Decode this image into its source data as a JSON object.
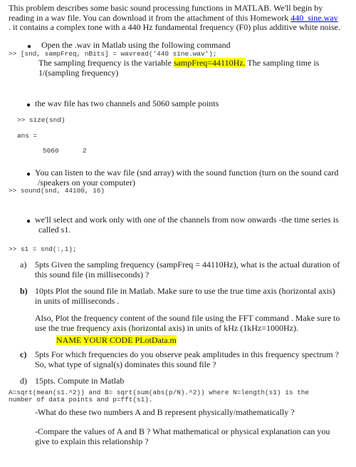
{
  "intro": {
    "line1": "This problem describes some basic sound processing functions in MATLAB. We'll begin by",
    "line2_prefix": "reading in a wav file. You can download it from the attachment of this Homework ",
    "link_text": "440_sine.wav",
    "line3": ". it contains a complex tone with a 440 Hz fundamental frequency (F0) plus additive white noise."
  },
  "bullet1": {
    "text": "Open the .wav in Matlab using the following command",
    "code": ">> [snd, sampFreq, nBits] = wavread('440 sine.wav');",
    "note_prefix": "The sampling frequency is the variable ",
    "note_highlight": "sampFreq=44110Hz.",
    "note_suffix": " The sampling time is",
    "note_line2": "1/(sampling frequency)"
  },
  "bullet2": {
    "text": "the wav file has two channels and 5060 sample points",
    "code1": ">> size(snd)",
    "code2": "ans =",
    "ans_rows": "5060",
    "ans_cols": "2"
  },
  "bullet3": {
    "line1": "You can listen to the wav file (snd array) with the sound function (turn on the sound card",
    "line2": "/speakers on your computer)",
    "code": ">> sound(snd, 44100, 16)"
  },
  "bullet4": {
    "line1": "we'll select and work only with one of the channels from now onwards -the time series is",
    "line2": "called s1.",
    "code": ">> s1 = snd(:,1);"
  },
  "questions": {
    "a": {
      "label": "a)",
      "line1": "5pts Given the sampling frequency (sampFreq = 44110Hz), what is the actual duration of",
      "line2": "this sound file (in milliseconds) ?"
    },
    "b": {
      "label": "b)",
      "line1": "10pts Plot the sound file in Matlab. Make sure to use the true time axis (horizontal axis)",
      "line2": "in units of milliseconds .",
      "line3": "Also, Plot the frequency content of the sound file using the FFT command . Make sure to",
      "line4": "use the true frequency axis (horizontal axis) in units of  kHz (1kHz=1000Hz).",
      "name_code": "NAME YOUR CODE PLotData.m"
    },
    "c": {
      "label": "c)",
      "line1": "5pts For which frequencies do you observe peak amplitudes in this frequency spectrum ?",
      "line2": "So, what type of signal(s) dominates this sound file ?"
    },
    "d": {
      "label": "d)",
      "line1": "15pts. Compute in Matlab",
      "code1": "A=sqrt(mean(s1.^2)) and B= sqrt(sum(abs(p/N).^2)) where N=length(s1) is the",
      "code2": "number of data points and p=fft(s1).",
      "q1": "-What do these two numbers A and B represent physically/mathematically ?",
      "q2_line1": "-Compare the values of A and B ? What mathematical or physical explanation can you",
      "q2_line2": "give to explain this relationship ?"
    }
  }
}
